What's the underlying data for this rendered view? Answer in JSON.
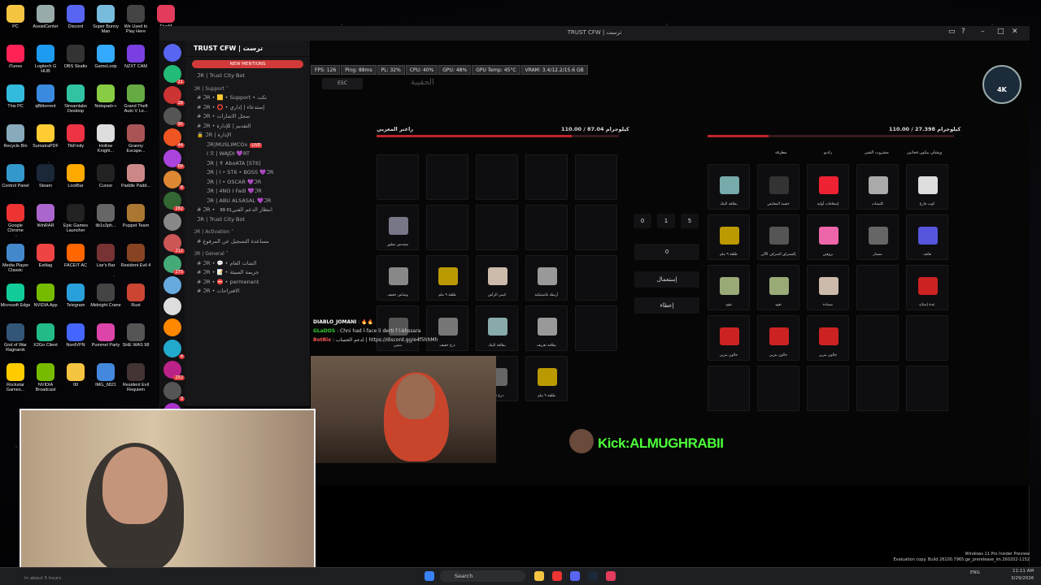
{
  "desktop": {
    "icons": [
      {
        "label": "PC",
        "color": "#f5c542"
      },
      {
        "label": "AssistCenter",
        "color": "#9aa"
      },
      {
        "label": "Discord",
        "color": "#5865f2"
      },
      {
        "label": "Super Bunny Man",
        "color": "#7bd"
      },
      {
        "label": "We Used to Play Here",
        "color": "#444"
      },
      {
        "label": "FiveM",
        "color": "#e23b5b"
      },
      {
        "label": "iTunes",
        "color": "#f25"
      },
      {
        "label": "Logitech G HUB",
        "color": "#1d9bf0"
      },
      {
        "label": "OBS Studio",
        "color": "#333"
      },
      {
        "label": "GameLoop",
        "color": "#3af"
      },
      {
        "label": "NZXT CAM",
        "color": "#7a3fe0"
      },
      {
        "label": "This PC",
        "color": "#3bd"
      },
      {
        "label": "qBittorrent",
        "color": "#3a8bdf"
      },
      {
        "label": "Streamlabs Desktop",
        "color": "#31c3a2"
      },
      {
        "label": "Notepad++",
        "color": "#8c4"
      },
      {
        "label": "Grand Theft Auto V Le...",
        "color": "#6a4"
      },
      {
        "label": "Recycle Bin",
        "color": "#8ab"
      },
      {
        "label": "SumatraPDF",
        "color": "#fc3"
      },
      {
        "label": "TikFinity",
        "color": "#e34"
      },
      {
        "label": "Hollow Knight...",
        "color": "#ddd"
      },
      {
        "label": "Granny Escape...",
        "color": "#a55"
      },
      {
        "label": "Control Panel",
        "color": "#39c"
      },
      {
        "label": "Steam",
        "color": "#1b2838"
      },
      {
        "label": "LootBar",
        "color": "#fa0"
      },
      {
        "label": "Cursor",
        "color": "#222"
      },
      {
        "label": "Paddle Padd...",
        "color": "#c88"
      },
      {
        "label": "Google Chrome",
        "color": "#e33"
      },
      {
        "label": "WinRAR",
        "color": "#a6c"
      },
      {
        "label": "Epic Games Launcher",
        "color": "#222"
      },
      {
        "label": "lib1s3ph...",
        "color": "#666"
      },
      {
        "label": "Puppet Team",
        "color": "#a73"
      },
      {
        "label": "Media Player Classic",
        "color": "#48c"
      },
      {
        "label": "Exitlag",
        "color": "#e44"
      },
      {
        "label": "FACEIT AC",
        "color": "#f60"
      },
      {
        "label": "Liar's Bar",
        "color": "#733"
      },
      {
        "label": "Resident Evil 4",
        "color": "#842"
      },
      {
        "label": "Microsoft Edge",
        "color": "#1c9"
      },
      {
        "label": "NVIDIA App",
        "color": "#7b0"
      },
      {
        "label": "Telegram",
        "color": "#2aa0da"
      },
      {
        "label": "Midnight Crane",
        "color": "#444"
      },
      {
        "label": "Rust",
        "color": "#c43"
      },
      {
        "label": "God of War Ragnarok",
        "color": "#357"
      },
      {
        "label": "X2Go Client",
        "color": "#2b8"
      },
      {
        "label": "NordVPN",
        "color": "#46f"
      },
      {
        "label": "Pummel Party",
        "color": "#d4a"
      },
      {
        "label": "SHE WAS 98",
        "color": "#555"
      },
      {
        "label": "Rockstar Games...",
        "color": "#fc0"
      },
      {
        "label": "NVIDIA Broadcast",
        "color": "#7b0"
      },
      {
        "label": "00",
        "color": "#f5c542"
      },
      {
        "label": "IMG_6821",
        "color": "#48d"
      },
      {
        "label": "Resident Evil Requiem",
        "color": "#433"
      }
    ]
  },
  "discord": {
    "window_title": "TRUST CFW | ترست",
    "server_name": "TRUST CFW | ترست",
    "new_mentions": "NEW MENTIONS",
    "guild_badges": [
      "",
      "21",
      "28",
      "95",
      "44",
      "68",
      "8",
      "282",
      "",
      "212",
      "275",
      "",
      "",
      "",
      "4",
      "252",
      "3",
      "474",
      "2",
      "1"
    ],
    "channels": [
      {
        "text": "ℑR | Trust City Bot",
        "type": "ch"
      },
      {
        "text": "ℑR | Support ˅",
        "type": "cat"
      },
      {
        "text": "# ℑR • 🟨 • Support • تكت",
        "type": "ch"
      },
      {
        "text": "# ℑR • ⭕ • إستدعاء | إداري",
        "type": "ch"
      },
      {
        "text": "# ℑR • سجل الاشارات",
        "type": "ch"
      },
      {
        "text": "# ℑR • التقديم | للإدارة",
        "type": "ch"
      },
      {
        "text": "🔒 ℑR | الإدارة",
        "type": "ch"
      },
      {
        "text": "ℑR|MUSLIMCOx",
        "type": "user",
        "live": "LIVE"
      },
      {
        "text": "I ℛ | WAJDI 💜RT",
        "type": "user"
      },
      {
        "text": "ℑR | ✝ AboATA [ST6]",
        "type": "user"
      },
      {
        "text": "ℑR | I • ST6 • BOSS 💜ℑR",
        "type": "user"
      },
      {
        "text": "ℑR | I • OSCAR 💜ℑR",
        "type": "user"
      },
      {
        "text": "ℑR | 4NO I Fadi 💜ℑR",
        "type": "user"
      },
      {
        "text": "ℑR | ABU ALSASAL 💜ℑR",
        "type": "user"
      },
      {
        "text": "# ℑR • انتظار الدعم الفني",
        "type": "ch",
        "count": "01 99"
      },
      {
        "text": "ℑR | Trust City Bot",
        "type": "ch"
      },
      {
        "text": "ℑR | Activation ˅",
        "type": "cat"
      },
      {
        "text": "# مساعدة التسجيل عن المرفوع",
        "type": "ch"
      },
      {
        "text": "ℑR | General ˅",
        "type": "cat"
      },
      {
        "text": "# ℑR • 💬 • الشات العام",
        "type": "ch"
      },
      {
        "text": "# ℑR • 📝 • جريمة السيئة",
        "type": "ch"
      },
      {
        "text": "# ℑR • ⛔ • permenant",
        "type": "ch"
      },
      {
        "text": "# ℑR • الاقتراحات",
        "type": "ch"
      }
    ]
  },
  "game": {
    "perf": [
      "FPS: 126",
      "Ping: 88ms",
      "PL: 32%",
      "CPU: 40%",
      "GPU: 48%",
      "GPU Temp: 45°C",
      "VRAM: 3.4/12.2/15.6 GB"
    ],
    "esc": "ESC",
    "bag_title": "الحقيبة",
    "left_inv_label": "راغنر المغربي",
    "left_weight": "110.00 / 87.04 كيلوجرام",
    "right_weight": "110.00 / 27.398 كيلوجرام",
    "right_columns": [
      "ويشلي بيكون فجاثين",
      "مشروب الشن",
      "راديو",
      "مطرقة"
    ],
    "left_slots": [
      {
        "label": "مسدس مطور"
      },
      {
        "label": "وشاش خفيف"
      },
      {
        "label": "طلقة ٩ ملم"
      },
      {
        "label": "كيس الرأس"
      },
      {
        "label": "أربطة بلاستيكية"
      },
      {
        "label": "ستين"
      },
      {
        "label": "درع خفيف"
      },
      {
        "label": "بطاقة البنك"
      },
      {
        "label": "بطاقة تعريف"
      },
      {
        "label": "جلوك"
      },
      {
        "label": "درع ثقيل"
      },
      {
        "label": "طلقة ٩ ملم"
      }
    ],
    "right_slots": [
      {
        "label": "بطاقة البنك",
        "color": "#7aa"
      },
      {
        "label": "حقيبة المقايض",
        "color": "#333"
      },
      {
        "label": "إسعافات أولية",
        "color": "#e23"
      },
      {
        "label": "كلبشات",
        "color": "#aaa"
      },
      {
        "label": "كوب فارغ",
        "color": "#ddd"
      },
      {
        "label": "طلقة ٩ ملم",
        "color": "#b90"
      },
      {
        "label": "إكسترلق الصراف الآلي",
        "color": "#555"
      },
      {
        "label": "بروفين",
        "color": "#e6a"
      },
      {
        "label": "منشار",
        "color": "#666"
      },
      {
        "label": "هاتف",
        "color": "#55d"
      },
      {
        "label": "نقود",
        "color": "#9a7"
      },
      {
        "label": "نقود",
        "color": "#9a7"
      },
      {
        "label": "ضمادة",
        "color": "#cba"
      },
      {
        "label": "",
        "color": ""
      },
      {
        "label": "عدة إصلاح",
        "color": "#c22"
      },
      {
        "label": "جالون بنزين",
        "color": "#c22"
      },
      {
        "label": "جالون بنزين",
        "color": "#c22"
      },
      {
        "label": "جالون بنزين",
        "color": "#c22"
      },
      {
        "label": "",
        "color": ""
      },
      {
        "label": "",
        "color": ""
      }
    ],
    "qty_buttons": [
      "0",
      "1",
      "5"
    ],
    "qty_value": "0",
    "use_label": "إستعمال",
    "give_label": "إعطاء",
    "chat": [
      {
        "name": "DIABLO_JOMANI",
        "text": "🔥🔥"
      },
      {
        "name": "GLaDOS",
        "text": "Chni had l-face li derti f l-khssara"
      },
      {
        "name": "BotRix",
        "text": "لدعم الحساب | https://discord.gg/e4f5hhMh"
      }
    ],
    "kick_text": "Kick:ALMUGHRABII",
    "logo_text": "4K"
  },
  "taskbar": {
    "search_placeholder": "Search",
    "lang": "ENG",
    "time": "11:11 AM",
    "date": "3/29/2026",
    "watermark_line1": "Windows 11 Pro Insider Preview",
    "watermark_line2": "Evaluation copy. Build 26100.7965.ge_prerelease_im.260202-1152",
    "notif": "In about 5 hours"
  }
}
